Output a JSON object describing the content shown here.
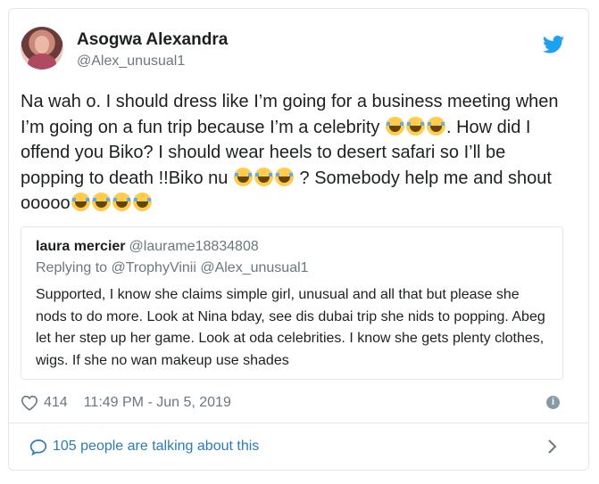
{
  "author": {
    "name": "Asogwa Alexandra",
    "handle": "@Alex_unusual1"
  },
  "tweet": {
    "segments": [
      "Na wah o. I should dress like I’m going for a business meeting when I’m going on a fun trip because I’m a celebrity ",
      ". How did I offend you Biko? I should wear heels to desert safari so I’ll be popping to death !!Biko nu ",
      " ? Somebody help me and shout ooooo"
    ],
    "emoji_icon": "face-with-tears-of-joy"
  },
  "quoted": {
    "name": "laura mercier",
    "handle": "@laurame18834808",
    "replying_to": "Replying to @TrophyVinii @Alex_unusual1",
    "text": "Supported, I know she claims simple girl, unusual and all that but please she nods to do more. Look at Nina bday, see dis dubai trip she nids to popping. Abeg let her step up her game. Look at oda celebrities.  I know she gets plenty clothes, wigs. If she no wan makeup use shades"
  },
  "meta": {
    "likes": "414",
    "timestamp": "11:49 PM - Jun 5, 2019"
  },
  "footer": {
    "talking": "105 people are talking about this"
  },
  "colors": {
    "brand": "#1da1f2",
    "link": "#2b7bb9",
    "secondary_text": "#697882",
    "border": "#e1e8ed"
  }
}
